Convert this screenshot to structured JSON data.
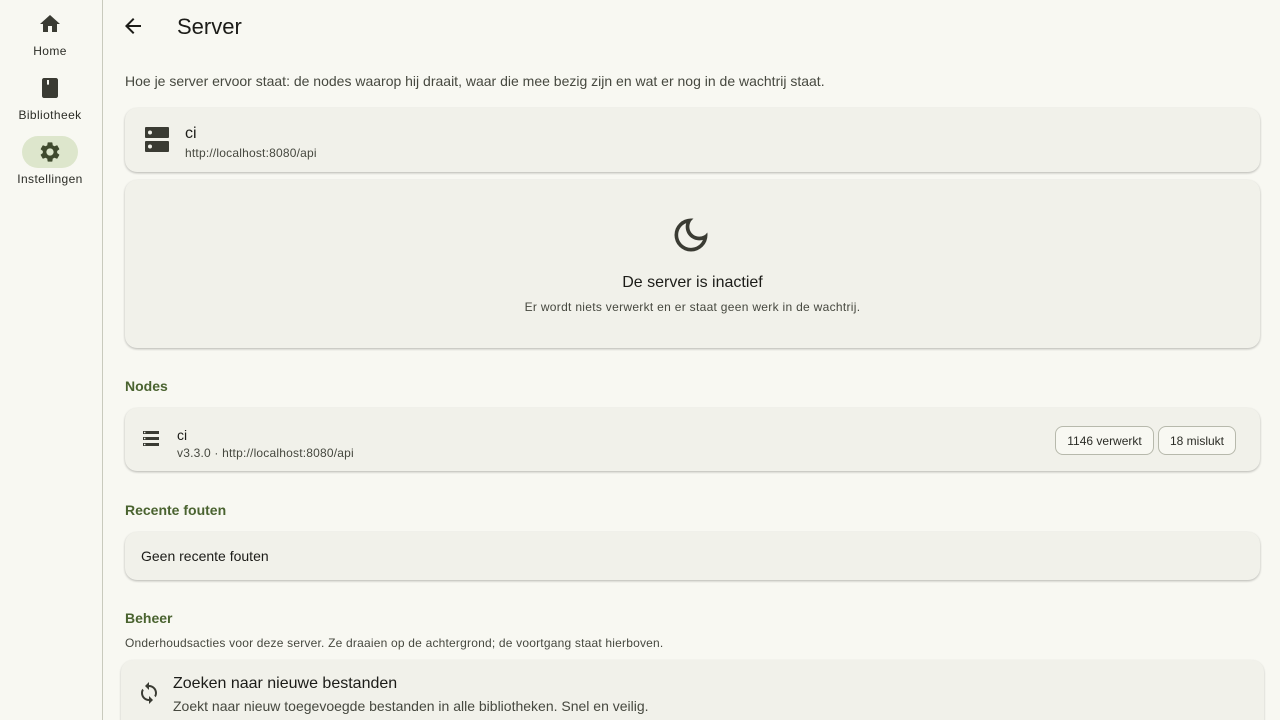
{
  "nav": {
    "items": [
      {
        "label": "Home",
        "icon": "home-icon"
      },
      {
        "label": "Bibliotheek",
        "icon": "book-icon"
      },
      {
        "label": "Instellingen",
        "icon": "gear-icon",
        "active": true
      }
    ]
  },
  "header": {
    "title": "Server",
    "back_icon": "arrow-back-icon"
  },
  "intro": "Hoe je server ervoor staat: de nodes waarop hij draait, waar die mee bezig zijn en wat er nog in de wachtrij staat.",
  "server": {
    "name": "ci",
    "url": "http://localhost:8080/api",
    "icon": "server-icon"
  },
  "status": {
    "icon": "moon-icon",
    "title": "De server is inactief",
    "subtitle": "Er wordt niets verwerkt en er staat geen werk in de wachtrij."
  },
  "nodes": {
    "heading": "Nodes",
    "items": [
      {
        "name": "ci",
        "meta": "v3.3.0 · http://localhost:8080/api",
        "processed_label": "1146 verwerkt",
        "failed_label": "18 mislukt"
      }
    ]
  },
  "errors": {
    "heading": "Recente fouten",
    "empty_text": "Geen recente fouten"
  },
  "manage": {
    "heading": "Beheer",
    "description": "Onderhoudsacties voor deze server. Ze draaien op de achtergrond; de voortgang staat hierboven.",
    "actions": [
      {
        "title": "Zoeken naar nieuwe bestanden",
        "description": "Zoekt naar nieuw toegevoegde bestanden in alle bibliotheken. Snel en veilig.",
        "icon": "sync-icon"
      }
    ]
  },
  "colors": {
    "background": "#f8f8f2",
    "card": "#f1f1ea",
    "accent": "#4a6330",
    "active_pill": "#dde6cc"
  }
}
